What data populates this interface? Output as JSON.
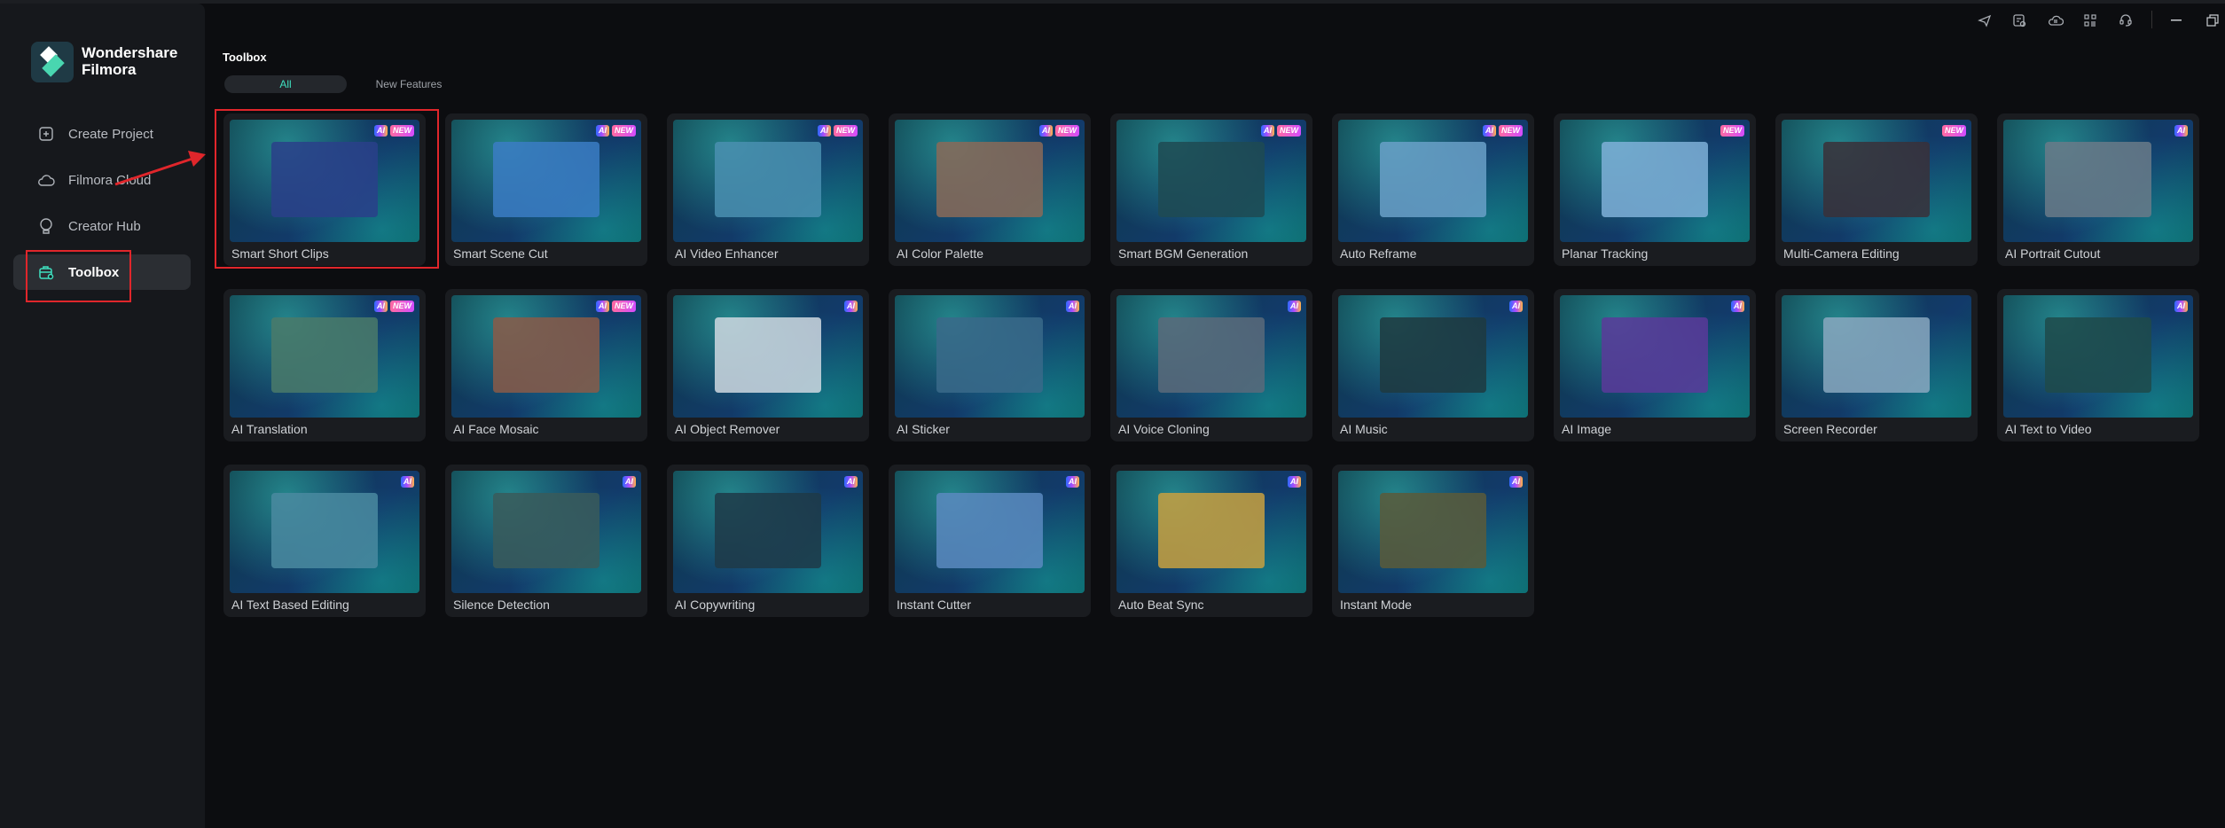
{
  "app": {
    "brand_line1": "Wondershare",
    "brand_line2": "Filmora"
  },
  "sidebar": {
    "items": [
      {
        "label": "Create Project",
        "icon": "plus-square-icon"
      },
      {
        "label": "Filmora Cloud",
        "icon": "cloud-icon"
      },
      {
        "label": "Creator Hub",
        "icon": "lightbulb-icon"
      },
      {
        "label": "Toolbox",
        "icon": "toolbox-icon",
        "active": true
      }
    ]
  },
  "main": {
    "title": "Toolbox",
    "tabs": [
      {
        "label": "All",
        "active": true
      },
      {
        "label": "New Features"
      }
    ],
    "tools": [
      {
        "label": "Smart Short Clips",
        "ai": true,
        "new": true,
        "color": "#2a3f8a"
      },
      {
        "label": "Smart Scene Cut",
        "ai": true,
        "new": true,
        "color": "#3b7cc4"
      },
      {
        "label": "AI Video Enhancer",
        "ai": true,
        "new": true,
        "color": "#4a8fb0"
      },
      {
        "label": "AI Color Palette",
        "ai": true,
        "new": true,
        "color": "#8a6a58"
      },
      {
        "label": "Smart BGM Generation",
        "ai": true,
        "new": true,
        "color": "#1f4a52"
      },
      {
        "label": "Auto Reframe",
        "ai": true,
        "new": true,
        "color": "#6aa0c8"
      },
      {
        "label": "Planar Tracking",
        "ai": false,
        "new": true,
        "color": "#7fb0d8"
      },
      {
        "label": "Multi-Camera Editing",
        "ai": false,
        "new": true,
        "color": "#3a3038"
      },
      {
        "label": "AI Portrait Cutout",
        "ai": true,
        "new": false,
        "color": "#6a7a88"
      },
      {
        "label": "AI Translation",
        "ai": true,
        "new": true,
        "color": "#4a7a6a"
      },
      {
        "label": "AI Face Mosaic",
        "ai": true,
        "new": true,
        "color": "#8a5a48"
      },
      {
        "label": "AI Object Remover",
        "ai": true,
        "new": false,
        "color": "#cfd8e0"
      },
      {
        "label": "AI Sticker",
        "ai": true,
        "new": false,
        "color": "#3a6a8a"
      },
      {
        "label": "AI Voice Cloning",
        "ai": true,
        "new": false,
        "color": "#5a6a7a"
      },
      {
        "label": "AI Music",
        "ai": true,
        "new": false,
        "color": "#1e3a40"
      },
      {
        "label": "AI Image",
        "ai": true,
        "new": false,
        "color": "#5a3a9a"
      },
      {
        "label": "Screen Recorder",
        "ai": false,
        "new": false,
        "color": "#8aa8c0"
      },
      {
        "label": "AI Text to Video",
        "ai": true,
        "new": false,
        "color": "#1e4a4a"
      },
      {
        "label": "AI Text Based Editing",
        "ai": true,
        "new": false,
        "color": "#4a8aa0"
      },
      {
        "label": "Silence Detection",
        "ai": true,
        "new": false,
        "color": "#3a5a5a"
      },
      {
        "label": "AI Copywriting",
        "ai": true,
        "new": false,
        "color": "#1e3a48"
      },
      {
        "label": "Instant Cutter",
        "ai": true,
        "new": false,
        "color": "#5a8ac0"
      },
      {
        "label": "Auto Beat Sync",
        "ai": true,
        "new": false,
        "color": "#c8a040"
      },
      {
        "label": "Instant Mode",
        "ai": true,
        "new": false,
        "color": "#5a5a3a"
      }
    ]
  },
  "badges": {
    "ai": "AI",
    "new": "NEW"
  },
  "titlebar_icons": [
    "send-feedback-icon",
    "task-list-icon",
    "cloud-sync-icon",
    "apps-grid-icon",
    "headset-support-icon",
    "minimize-icon",
    "restore-icon"
  ],
  "colors": {
    "accent": "#3fe0c0",
    "annotation": "#e0262b"
  }
}
